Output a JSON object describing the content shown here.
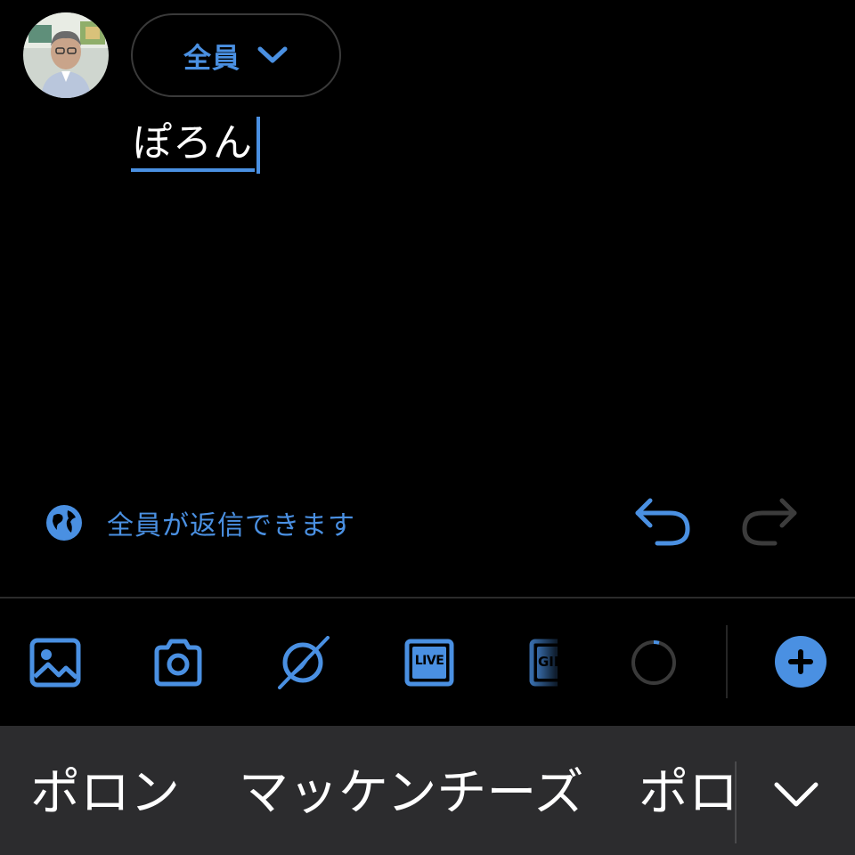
{
  "header": {
    "avatar": "user-avatar-photo",
    "audience_label": "全員",
    "audience_icon": "chevron-down-icon"
  },
  "composer": {
    "text": "ぽろん"
  },
  "reply_setting": {
    "icon": "globe-icon",
    "label": "全員が返信できます"
  },
  "history": {
    "undo_icon": "undo-icon",
    "redo_icon": "redo-icon"
  },
  "toolbar": {
    "items": [
      "image-icon",
      "camera-icon",
      "spaces-icon",
      "live-icon",
      "gif-icon",
      "character-count-icon"
    ],
    "live_label": "LIVE",
    "gif_label": "GIF",
    "add_icon": "add-thread-icon"
  },
  "candidates": {
    "items": [
      "ポロン",
      "マッケンチーズ",
      "ポロ"
    ],
    "expand_icon": "chevron-down-icon"
  },
  "colors": {
    "accent": "#4a90e2",
    "background": "#000000",
    "candidate_bar": "#2c2c2e",
    "disabled": "#3c3c3c"
  }
}
